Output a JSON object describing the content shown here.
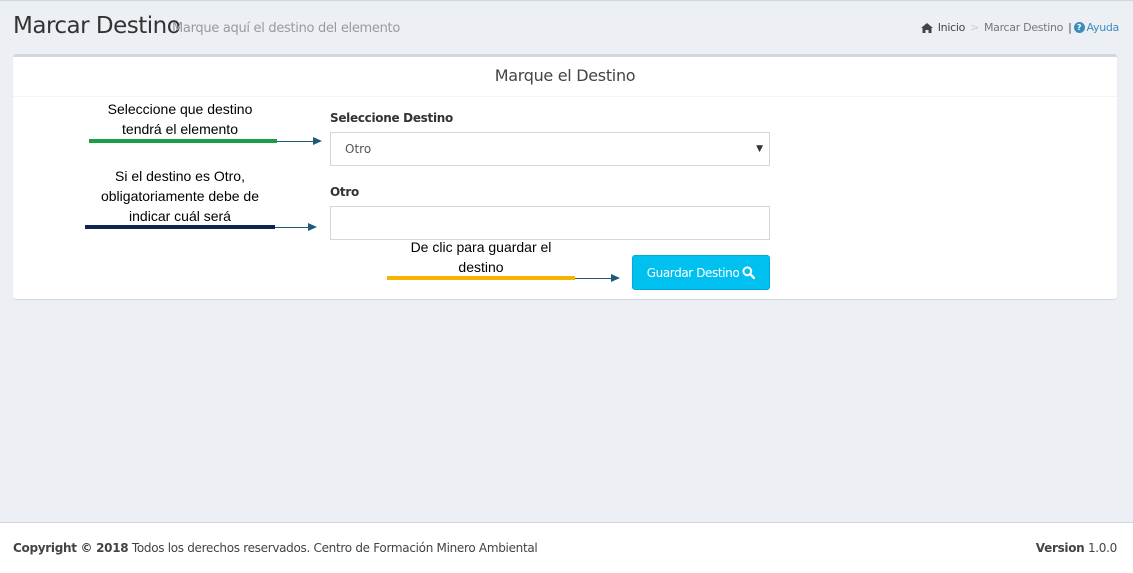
{
  "header": {
    "title": "Marcar Destino",
    "subtitle": "Marque aquí el destino del elemento"
  },
  "breadcrumb": {
    "home_icon": "home-icon",
    "home": "Inicio",
    "separator": ">",
    "current": "Marcar Destino",
    "divider": "|",
    "help_icon": "question-circle-icon",
    "help": "Ayuda"
  },
  "box": {
    "title": "Marque el Destino"
  },
  "form": {
    "select_label": "Seleccione Destino",
    "select_value": "Otro",
    "other_label": "Otro",
    "other_value": "",
    "submit_label": "Guardar Destino",
    "submit_icon": "search-icon"
  },
  "annotations": {
    "select": {
      "line1": "Seleccione que destino",
      "line2": "tendrá el elemento",
      "color": "#1a9e4a"
    },
    "other": {
      "line1": "Si el destino es Otro,",
      "line2": "obligatoriamente debe de",
      "line3": "indicar cuál será",
      "color": "#0d2550"
    },
    "submit": {
      "line1": "De clic para guardar el",
      "line2": "destino",
      "color": "#f5b400"
    }
  },
  "footer": {
    "copyright_bold": "Copyright © 2018",
    "copyright_text": "Todos los derechos reservados. Centro de Formación Minero Ambiental",
    "version_bold": "Version",
    "version_value": "1.0.0"
  },
  "colors": {
    "accent": "#00c0ef",
    "link": "#3c8dbc",
    "background": "#ecf0f5"
  }
}
